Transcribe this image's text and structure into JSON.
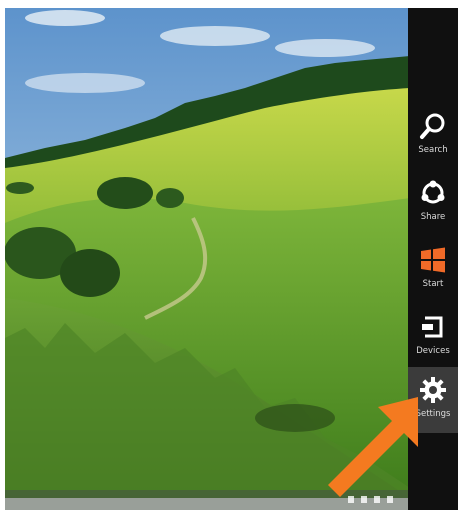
{
  "charms": {
    "items": [
      {
        "label": "Search",
        "icon": "search-icon"
      },
      {
        "label": "Share",
        "icon": "share-icon"
      },
      {
        "label": "Start",
        "icon": "windows-logo-icon"
      },
      {
        "label": "Devices",
        "icon": "devices-icon"
      },
      {
        "label": "Settings",
        "icon": "gear-icon",
        "selected": true
      }
    ]
  },
  "colors": {
    "charm_bar": "#101010",
    "selected_charm": "#3b3b3b",
    "start_logo": "#f06a28",
    "arrow": "#f47a20",
    "sky": "#7fb0dc",
    "hills": "#8fbf3a"
  }
}
